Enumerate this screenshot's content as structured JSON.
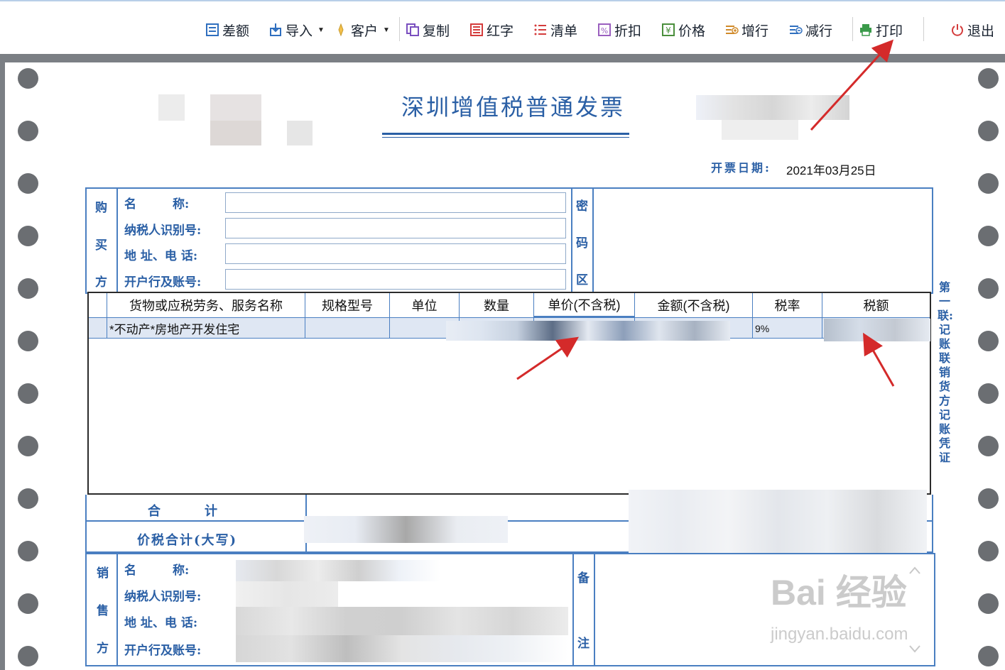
{
  "toolbar": {
    "items": [
      {
        "label": "差额",
        "icon": "list-icon"
      },
      {
        "label": "导入",
        "icon": "import-icon",
        "dropdown": true
      },
      {
        "label": "客户",
        "icon": "customer-icon",
        "dropdown": true
      },
      {
        "label": "复制",
        "icon": "copy-icon"
      },
      {
        "label": "红字",
        "icon": "red-invoice-icon"
      },
      {
        "label": "清单",
        "icon": "checklist-icon"
      },
      {
        "label": "折扣",
        "icon": "discount-icon"
      },
      {
        "label": "价格",
        "icon": "price-icon"
      },
      {
        "label": "增行",
        "icon": "add-row-icon"
      },
      {
        "label": "减行",
        "icon": "remove-row-icon"
      },
      {
        "label": "打印",
        "icon": "print-icon"
      },
      {
        "label": "退出",
        "icon": "power-icon"
      }
    ]
  },
  "invoice": {
    "title": "深圳增值税普通发票",
    "date_label": "开票日期:",
    "date_value": "2021年03月25日",
    "buyer": {
      "side_label": [
        "购",
        "买",
        "方"
      ],
      "fields": [
        "名　　　称:",
        "纳税人识别号:",
        "地 址、电 话:",
        "开户行及账号:"
      ]
    },
    "password_zone": [
      "密",
      "码",
      "区"
    ],
    "table": {
      "headers": [
        "货物或应税劳务、服务名称",
        "规格型号",
        "单位",
        "数量",
        "单价(不含税)",
        "金额(不含税)",
        "税率",
        "税额"
      ],
      "rows": [
        {
          "name": "*不动产*房地产开发住宅",
          "spec": "",
          "unit": "",
          "qty": "",
          "price": "",
          "amount": "",
          "rate": "9%",
          "tax": ""
        }
      ]
    },
    "total_label": "合　　　计",
    "total_caps_label": "价税合计(大写)",
    "seller": {
      "side_label": [
        "销",
        "售",
        "方"
      ],
      "fields": [
        "名　　　称:",
        "纳税人识别号:",
        "地 址、电 话:",
        "开户行及账号:"
      ]
    },
    "remarks_label": [
      "备",
      "注"
    ],
    "copy_note": "第一联:记账联 销货方记账凭证"
  },
  "watermark": {
    "brand": "Bai 经验",
    "url": "jingyan.baidu.com"
  },
  "colors": {
    "accent": "#2a5fa5",
    "arrow": "#d42a2a",
    "grid": "#4a7fc1"
  }
}
